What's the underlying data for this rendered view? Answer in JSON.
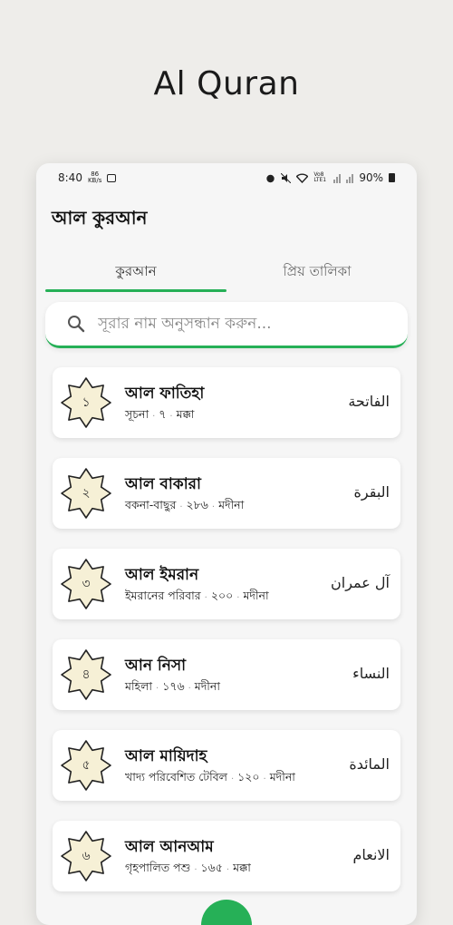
{
  "promo": {
    "title": "Al Quran"
  },
  "status": {
    "time": "8:40",
    "kb_top": "86",
    "kb_bottom": "KB/s",
    "net": "Vo8 LTE1",
    "battery": "90%"
  },
  "app": {
    "title": "আল কুরআন"
  },
  "tabs": [
    {
      "label": "কুরআন",
      "active": true
    },
    {
      "label": "প্রিয় তালিকা",
      "active": false
    }
  ],
  "search": {
    "placeholder": "সূরার নাম অনুসন্ধান করুন...",
    "value": ""
  },
  "surahs": [
    {
      "num": "১",
      "name": "আল ফাতিহা",
      "meaning": "সূচনা",
      "ayat": "৭",
      "place": "মক্কা",
      "arabic": "الفاتحة"
    },
    {
      "num": "২",
      "name": "আল বাকারা",
      "meaning": "বকনা-বাছুর",
      "ayat": "২৮৬",
      "place": "মদীনা",
      "arabic": "البقرة"
    },
    {
      "num": "৩",
      "name": "আল ইমরান",
      "meaning": "ইমরানের পরিবার",
      "ayat": "২০০",
      "place": "মদীনা",
      "arabic": "آل عمران"
    },
    {
      "num": "৪",
      "name": "আন নিসা",
      "meaning": "মহিলা",
      "ayat": "১৭৬",
      "place": "মদীনা",
      "arabic": "النساء"
    },
    {
      "num": "৫",
      "name": "আল মায়িদাহ",
      "meaning": "খাদ্য পরিবেশিত টেবিল",
      "ayat": "১২০",
      "place": "মদীনা",
      "arabic": "المائدة"
    },
    {
      "num": "৬",
      "name": "আল আনআম",
      "meaning": "গৃহপালিত পশু",
      "ayat": "১৬৫",
      "place": "মক্কা",
      "arabic": "الانعام"
    }
  ],
  "colors": {
    "accent": "#26b057",
    "star_fill": "#f6f0d6",
    "star_stroke": "#222222"
  },
  "icons": {
    "search": "search-icon",
    "badge": "star-badge-icon"
  }
}
